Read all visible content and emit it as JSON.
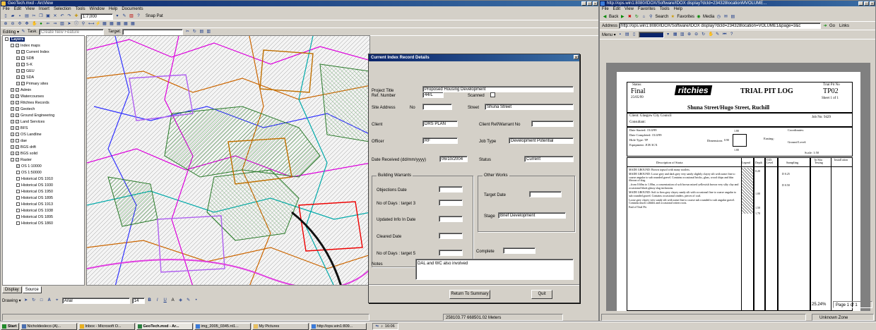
{
  "arcmap": {
    "title": "GeoTech.mxd - ArcView",
    "menu": [
      "File",
      "Edit",
      "View",
      "Insert",
      "Selection",
      "Tools",
      "Window",
      "Help",
      "Documents"
    ],
    "scale": "1:7,000",
    "snapping": "Snap Pat",
    "editor_label": "Editing ▾",
    "task_label": "Task:",
    "task_value": "Create New Feature",
    "target_label": "Target:",
    "toc_title": "Layers",
    "layers": [
      {
        "indent": 0,
        "name": "Layers",
        "checked": false,
        "expand": "-"
      },
      {
        "indent": 1,
        "name": "Index maps",
        "checked": true,
        "expand": "-"
      },
      {
        "indent": 2,
        "name": "Current Index",
        "checked": true,
        "expand": "+"
      },
      {
        "indent": 2,
        "name": "SDB",
        "checked": true,
        "expand": "+"
      },
      {
        "indent": 2,
        "name": "S-K",
        "checked": true,
        "expand": "+"
      },
      {
        "indent": 2,
        "name": "GEU",
        "checked": true,
        "expand": "+"
      },
      {
        "indent": 2,
        "name": "SDA",
        "checked": true,
        "expand": "+"
      },
      {
        "indent": 2,
        "name": "Primary sites",
        "checked": true,
        "expand": "+"
      },
      {
        "indent": 1,
        "name": "Admin",
        "checked": true,
        "expand": "+"
      },
      {
        "indent": 1,
        "name": "Watercourses",
        "checked": true,
        "expand": "+"
      },
      {
        "indent": 1,
        "name": "Ritchies Records",
        "checked": true,
        "expand": "+"
      },
      {
        "indent": 1,
        "name": "Geotech",
        "checked": true,
        "expand": "+"
      },
      {
        "indent": 1,
        "name": "Ground Engineering",
        "checked": true,
        "expand": "+"
      },
      {
        "indent": 1,
        "name": "Land Services",
        "checked": true,
        "expand": "+"
      },
      {
        "indent": 1,
        "name": "BFS",
        "checked": true,
        "expand": "+"
      },
      {
        "indent": 1,
        "name": "OS Landline",
        "checked": false,
        "expand": "+"
      },
      {
        "indent": 1,
        "name": "dae",
        "checked": false,
        "expand": "+"
      },
      {
        "indent": 1,
        "name": "BGS drift",
        "checked": true,
        "expand": "+"
      },
      {
        "indent": 1,
        "name": "BGS solid",
        "checked": true,
        "expand": "+"
      },
      {
        "indent": 1,
        "name": "Raster",
        "checked": true,
        "expand": "-"
      },
      {
        "indent": 2,
        "name": "OS 1:10000",
        "checked": true,
        "expand": ""
      },
      {
        "indent": 2,
        "name": "OS 1:50000",
        "checked": false,
        "expand": ""
      },
      {
        "indent": 2,
        "name": "Historical OS 1910",
        "checked": false,
        "expand": ""
      },
      {
        "indent": 2,
        "name": "Historical OS 1930",
        "checked": false,
        "expand": ""
      },
      {
        "indent": 2,
        "name": "Historical OS 1950",
        "checked": false,
        "expand": ""
      },
      {
        "indent": 2,
        "name": "Historical OS 1895",
        "checked": false,
        "expand": ""
      },
      {
        "indent": 2,
        "name": "Historical OS 1913",
        "checked": false,
        "expand": ""
      },
      {
        "indent": 2,
        "name": "Historical OS 1938",
        "checked": false,
        "expand": ""
      },
      {
        "indent": 2,
        "name": "Historical OS 1895",
        "checked": false,
        "expand": ""
      },
      {
        "indent": 2,
        "name": "Historical OS 1860",
        "checked": false,
        "expand": ""
      }
    ],
    "toc_tabs": [
      "Display",
      "Source"
    ],
    "drawing_label": "Drawing ▾",
    "font_name": "Arial",
    "font_size": "14",
    "coords": "258103.77  668501.02 Meters",
    "status_left": ""
  },
  "dialog": {
    "title": "Current Index Record Details",
    "ref_label": "Ref. Number",
    "ref_value": "44/L",
    "scanned_label": "Scanned",
    "project_label": "Project Title",
    "project_value": "Proposed Housing Development",
    "site_label": "Site Address",
    "no_label": "No",
    "no_value": "",
    "street_label": "Street",
    "street_value": "Shuna Street",
    "client_label": "Client",
    "client_value": "DRS PLAN",
    "clientref_label": "Client Ref/Warrant No",
    "clientref_value": "",
    "officer_label": "Officer",
    "officer_value": "RF",
    "jobtype_label": "Job Type",
    "jobtype_value": "Development Potential",
    "date_label": "Date Received (dd/mm/yyyy)",
    "date_value": "06/10/2004",
    "status_label": "Status",
    "status_value": "Current",
    "bw_title": "Building Warrants",
    "objections_label": "Objections Date",
    "objections_value": "",
    "days1_label": "No of Days : target 3",
    "days1_value": "",
    "updated_label": "Updated Info In Date",
    "updated_value": "",
    "cleared_label": "Cleared Date",
    "cleared_value": "",
    "days2_label": "No of Days : target 5",
    "days2_value": "",
    "ow_title": "Other Works",
    "target_label": "Target Date",
    "target_value": "",
    "stage_label": "Stage",
    "stage_value": "Brief Development",
    "complete_label": "Complete",
    "complete_value": "",
    "notes_label": "Notes",
    "notes_value": "DAL and WC also involved",
    "return_btn": "Return To Summary",
    "quit_btn": "Quit"
  },
  "browser": {
    "title": "http://ops.win1:8080/IDOX/Software/IDOX display?dcId=234328locationMVOLUME...",
    "menu": [
      "File",
      "Edit",
      "View",
      "Favorites",
      "Tools",
      "Help"
    ],
    "back": "Back",
    "search": "Search",
    "favorites": "Favorites",
    "media": "Media",
    "address_label": "Address",
    "address_value": "http://ops.win1:8080/IDOX/Software/IDOX display?dcId=234328location=VOLUME1&page=3&c",
    "go": "Go",
    "links": "Links",
    "viewer_menu": "Menu ▾",
    "zoom_value": "25.24%",
    "page_info": "Page 1 of 1",
    "zone": "Unknown Zone"
  },
  "log": {
    "status_label": "Status:",
    "status_value": "Final",
    "status_date": "25/05/99",
    "brand": "ritchies",
    "heading": "TRIAL PIT LOG",
    "pit_label": "Trial Pit No",
    "pit_no": "TP02",
    "sheet": "Sheet 1 of 1",
    "site": "Shuna Street/Hugo Street, Ruchill",
    "client": "Client:    Glasgow City Council",
    "consultant": "Consultant:",
    "job": "Job No: 9429",
    "date_started": "Date Started:      15/4/99",
    "date_completed": "Date Completed:  15/4/99",
    "hole_type": "Hole Type:          TP",
    "equipment": "Equipment:          JCB 3CX",
    "dimensions": "Dimensions",
    "dim_length": "1.80",
    "dim_width": "0.90",
    "dim_depth": "1.80",
    "easting": "Easting:",
    "coordinates": "Coordinates:",
    "ground": "Ground Level:",
    "scale": "Scale:         1:50",
    "col_desc": "Description of Strata",
    "col_legend": "Legend",
    "col_depth": "Depth",
    "col_od": "O.D. Level",
    "col_sampling": "Sampling",
    "col_insitu": "In Situ Testing",
    "col_install": "Install ation",
    "strata": [
      "MADE GROUND:  Brown topsoil with many rootlets.",
      "MADE GROUND:  Loose grey and dark grey very sandy slightly clayey silt with some fine to coarse angular to sub rounded gravel.  Contains occasional bricks, glass, wood chips and thin fibrous of slag.",
      "...from 0.60m to 1.00m, a concentration of soft brown mixed yellowish brown very silty clay and occasional black glassy slag inclusions.",
      "MADE GROUND:  Soft to firm grey clayey sandy silt with occasional fine to coarse angular to sub rounded gravel.  Contains occasional cinders, pieces of coal.",
      "Loose grey clayey very sandy silt with some fine to coarse sub rounded to sub angular gravel.  Contains much cobbles and occasional rotten roots.",
      "End of Trial Pit."
    ],
    "depths": [
      "0.20",
      "1.00",
      "1.50",
      "1.70"
    ],
    "samples": [
      "D  0.25",
      "D  0.50"
    ]
  },
  "taskbar": {
    "start": "Start",
    "items": [
      "Nicholdesleco (A)...",
      "Inbox - Microsoft O...",
      "GeoTech.mxd - Ar...",
      "img_2005_0345.nt1...",
      "My Pictures",
      "http://ops.win1:809..."
    ],
    "clock": "16:06"
  }
}
